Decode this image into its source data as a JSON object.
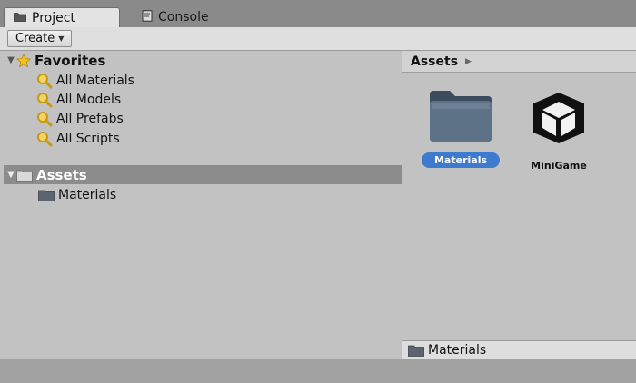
{
  "tabs": [
    {
      "label": "Project",
      "icon": "folder-icon",
      "active": true
    },
    {
      "label": "Console",
      "icon": "console-icon",
      "active": false
    }
  ],
  "toolbar": {
    "create_label": "Create"
  },
  "favorites": {
    "label": "Favorites",
    "items": [
      {
        "label": "All Materials"
      },
      {
        "label": "All Models"
      },
      {
        "label": "All Prefabs"
      },
      {
        "label": "All Scripts"
      }
    ]
  },
  "assets_tree": {
    "label": "Assets",
    "children": [
      {
        "label": "Materials"
      }
    ]
  },
  "right_panel": {
    "breadcrumb": "Assets",
    "items": [
      {
        "label": "Materials",
        "icon": "folder-icon",
        "selected": true
      },
      {
        "label": "MiniGame",
        "icon": "unity-logo-icon",
        "selected": false
      }
    ],
    "footer_path": "Materials"
  },
  "colors": {
    "selection_blue": "#3e7bcf",
    "tree_selected": "#8c8c8c",
    "panel_bg": "#c2c2c2",
    "star_yellow": "#f2c21a"
  }
}
